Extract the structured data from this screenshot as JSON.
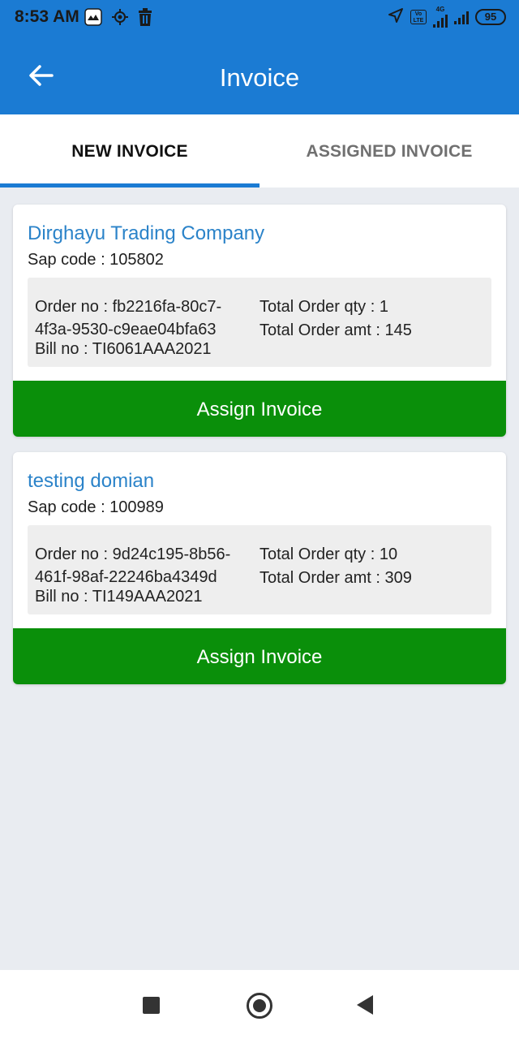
{
  "status_bar": {
    "time": "8:53 AM",
    "network": "4G",
    "battery": "95",
    "icons": [
      "app-notification-icon",
      "location-target-icon",
      "trash-icon",
      "navigation-arrow-icon",
      "volte-icon",
      "signal-icon",
      "battery-icon"
    ]
  },
  "appbar": {
    "title": "Invoice",
    "back_icon": "arrow-left-icon"
  },
  "tabs": [
    {
      "label": "NEW INVOICE",
      "active": true
    },
    {
      "label": "ASSIGNED INVOICE",
      "active": false
    }
  ],
  "colors": {
    "primary": "#1b7bd3",
    "assign_button": "#0a8f0a",
    "company_name": "#2b83c9",
    "background": "#e9ecf1"
  },
  "invoices": [
    {
      "company": "Dirghayu Trading Company",
      "sap_code": "Sap code : 105802",
      "order_no": "Order no : fb2216fa-80c7-4f3a-9530-c9eae04bfa63",
      "bill_no": "Bill no : TI6061AAA2021",
      "total_qty": "Total Order qty : 1",
      "total_amt": "Total Order amt : 145",
      "button_label": "Assign Invoice"
    },
    {
      "company": "testing domian",
      "sap_code": "Sap code : 100989",
      "order_no": "Order no : 9d24c195-8b56-461f-98af-22246ba4349d",
      "bill_no": "Bill no : TI149AAA2021",
      "total_qty": "Total Order qty : 10",
      "total_amt": "Total Order amt : 309",
      "button_label": "Assign Invoice"
    }
  ],
  "nav_bar": {
    "icons": [
      "recents-square-icon",
      "home-circle-icon",
      "back-triangle-icon"
    ]
  }
}
